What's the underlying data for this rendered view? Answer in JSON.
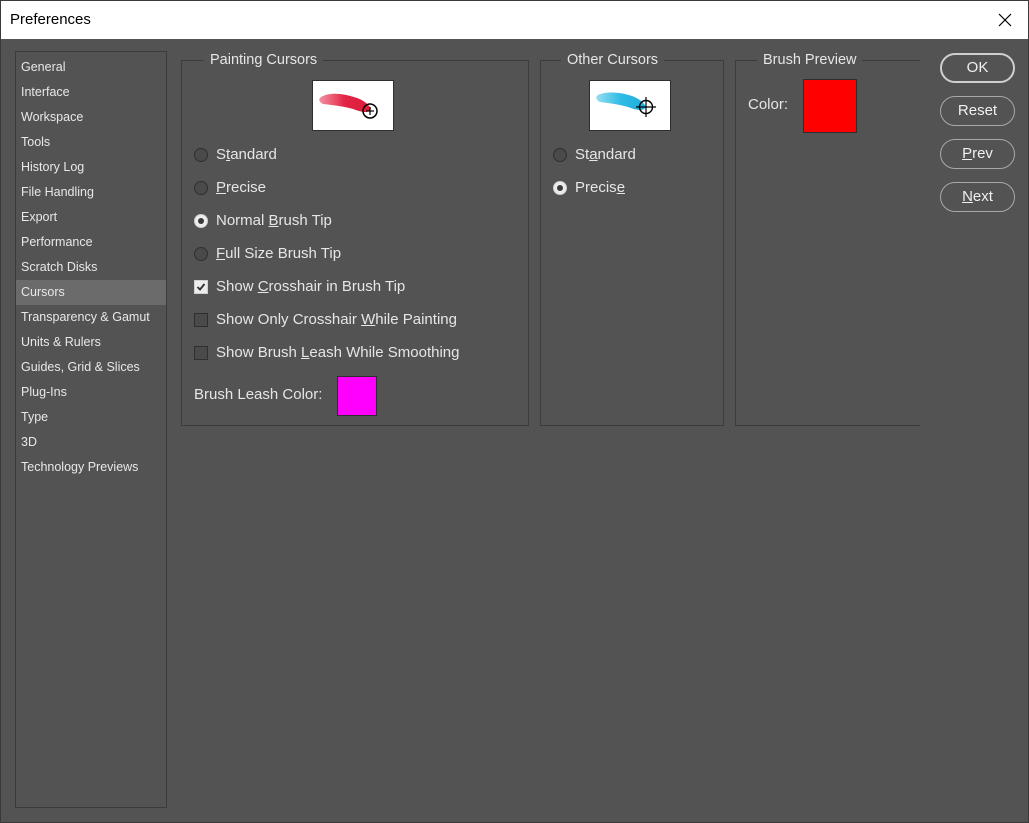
{
  "window": {
    "title": "Preferences"
  },
  "sidebar": {
    "items": [
      {
        "label": "General",
        "selected": false
      },
      {
        "label": "Interface",
        "selected": false
      },
      {
        "label": "Workspace",
        "selected": false
      },
      {
        "label": "Tools",
        "selected": false
      },
      {
        "label": "History Log",
        "selected": false
      },
      {
        "label": "File Handling",
        "selected": false
      },
      {
        "label": "Export",
        "selected": false
      },
      {
        "label": "Performance",
        "selected": false
      },
      {
        "label": "Scratch Disks",
        "selected": false
      },
      {
        "label": "Cursors",
        "selected": true
      },
      {
        "label": "Transparency & Gamut",
        "selected": false
      },
      {
        "label": "Units & Rulers",
        "selected": false
      },
      {
        "label": "Guides, Grid & Slices",
        "selected": false
      },
      {
        "label": "Plug-Ins",
        "selected": false
      },
      {
        "label": "Type",
        "selected": false
      },
      {
        "label": "3D",
        "selected": false
      },
      {
        "label": "Technology Previews",
        "selected": false
      }
    ]
  },
  "painting_cursors": {
    "title": "Painting Cursors",
    "preview_icon": "red-brush-stroke-crosshair-icon",
    "options": {
      "standard": {
        "pre": "S",
        "ul": "t",
        "post": "andard",
        "checked": false
      },
      "precise": {
        "pre": "",
        "ul": "P",
        "post": "recise",
        "checked": false
      },
      "normal_brush_tip": {
        "pre": "Normal ",
        "ul": "B",
        "post": "rush Tip",
        "checked": true
      },
      "full_size_brush_tip": {
        "pre": "",
        "ul": "F",
        "post": "ull Size Brush Tip",
        "checked": false
      }
    },
    "checkboxes": {
      "show_crosshair": {
        "pre": "Show ",
        "ul": "C",
        "post": "rosshair in Brush Tip",
        "checked": true
      },
      "show_only_crosshair": {
        "pre": "Show Only Crosshair ",
        "ul": "W",
        "post": "hile Painting",
        "checked": false
      },
      "show_brush_leash": {
        "pre": "Show Brush ",
        "ul": "L",
        "post": "eash While Smoothing",
        "checked": false
      }
    },
    "leash_color_label": "Brush Leash Color:",
    "leash_color": "#ff00ff"
  },
  "other_cursors": {
    "title": "Other Cursors",
    "preview_icon": "blue-brush-stroke-crosshair-icon",
    "options": {
      "standard": {
        "pre": "St",
        "ul": "a",
        "post": "ndard",
        "checked": false
      },
      "precise": {
        "pre": "Precis",
        "ul": "e",
        "post": "",
        "checked": true
      }
    }
  },
  "brush_preview": {
    "title": "Brush Preview",
    "color_label": "Color:",
    "color": "#ff0000"
  },
  "buttons": {
    "ok": {
      "pre": "OK",
      "ul": "",
      "post": ""
    },
    "reset": {
      "pre": "Reset",
      "ul": "",
      "post": ""
    },
    "prev": {
      "pre": "",
      "ul": "P",
      "post": "rev"
    },
    "next": {
      "pre": "",
      "ul": "N",
      "post": "ext"
    }
  }
}
